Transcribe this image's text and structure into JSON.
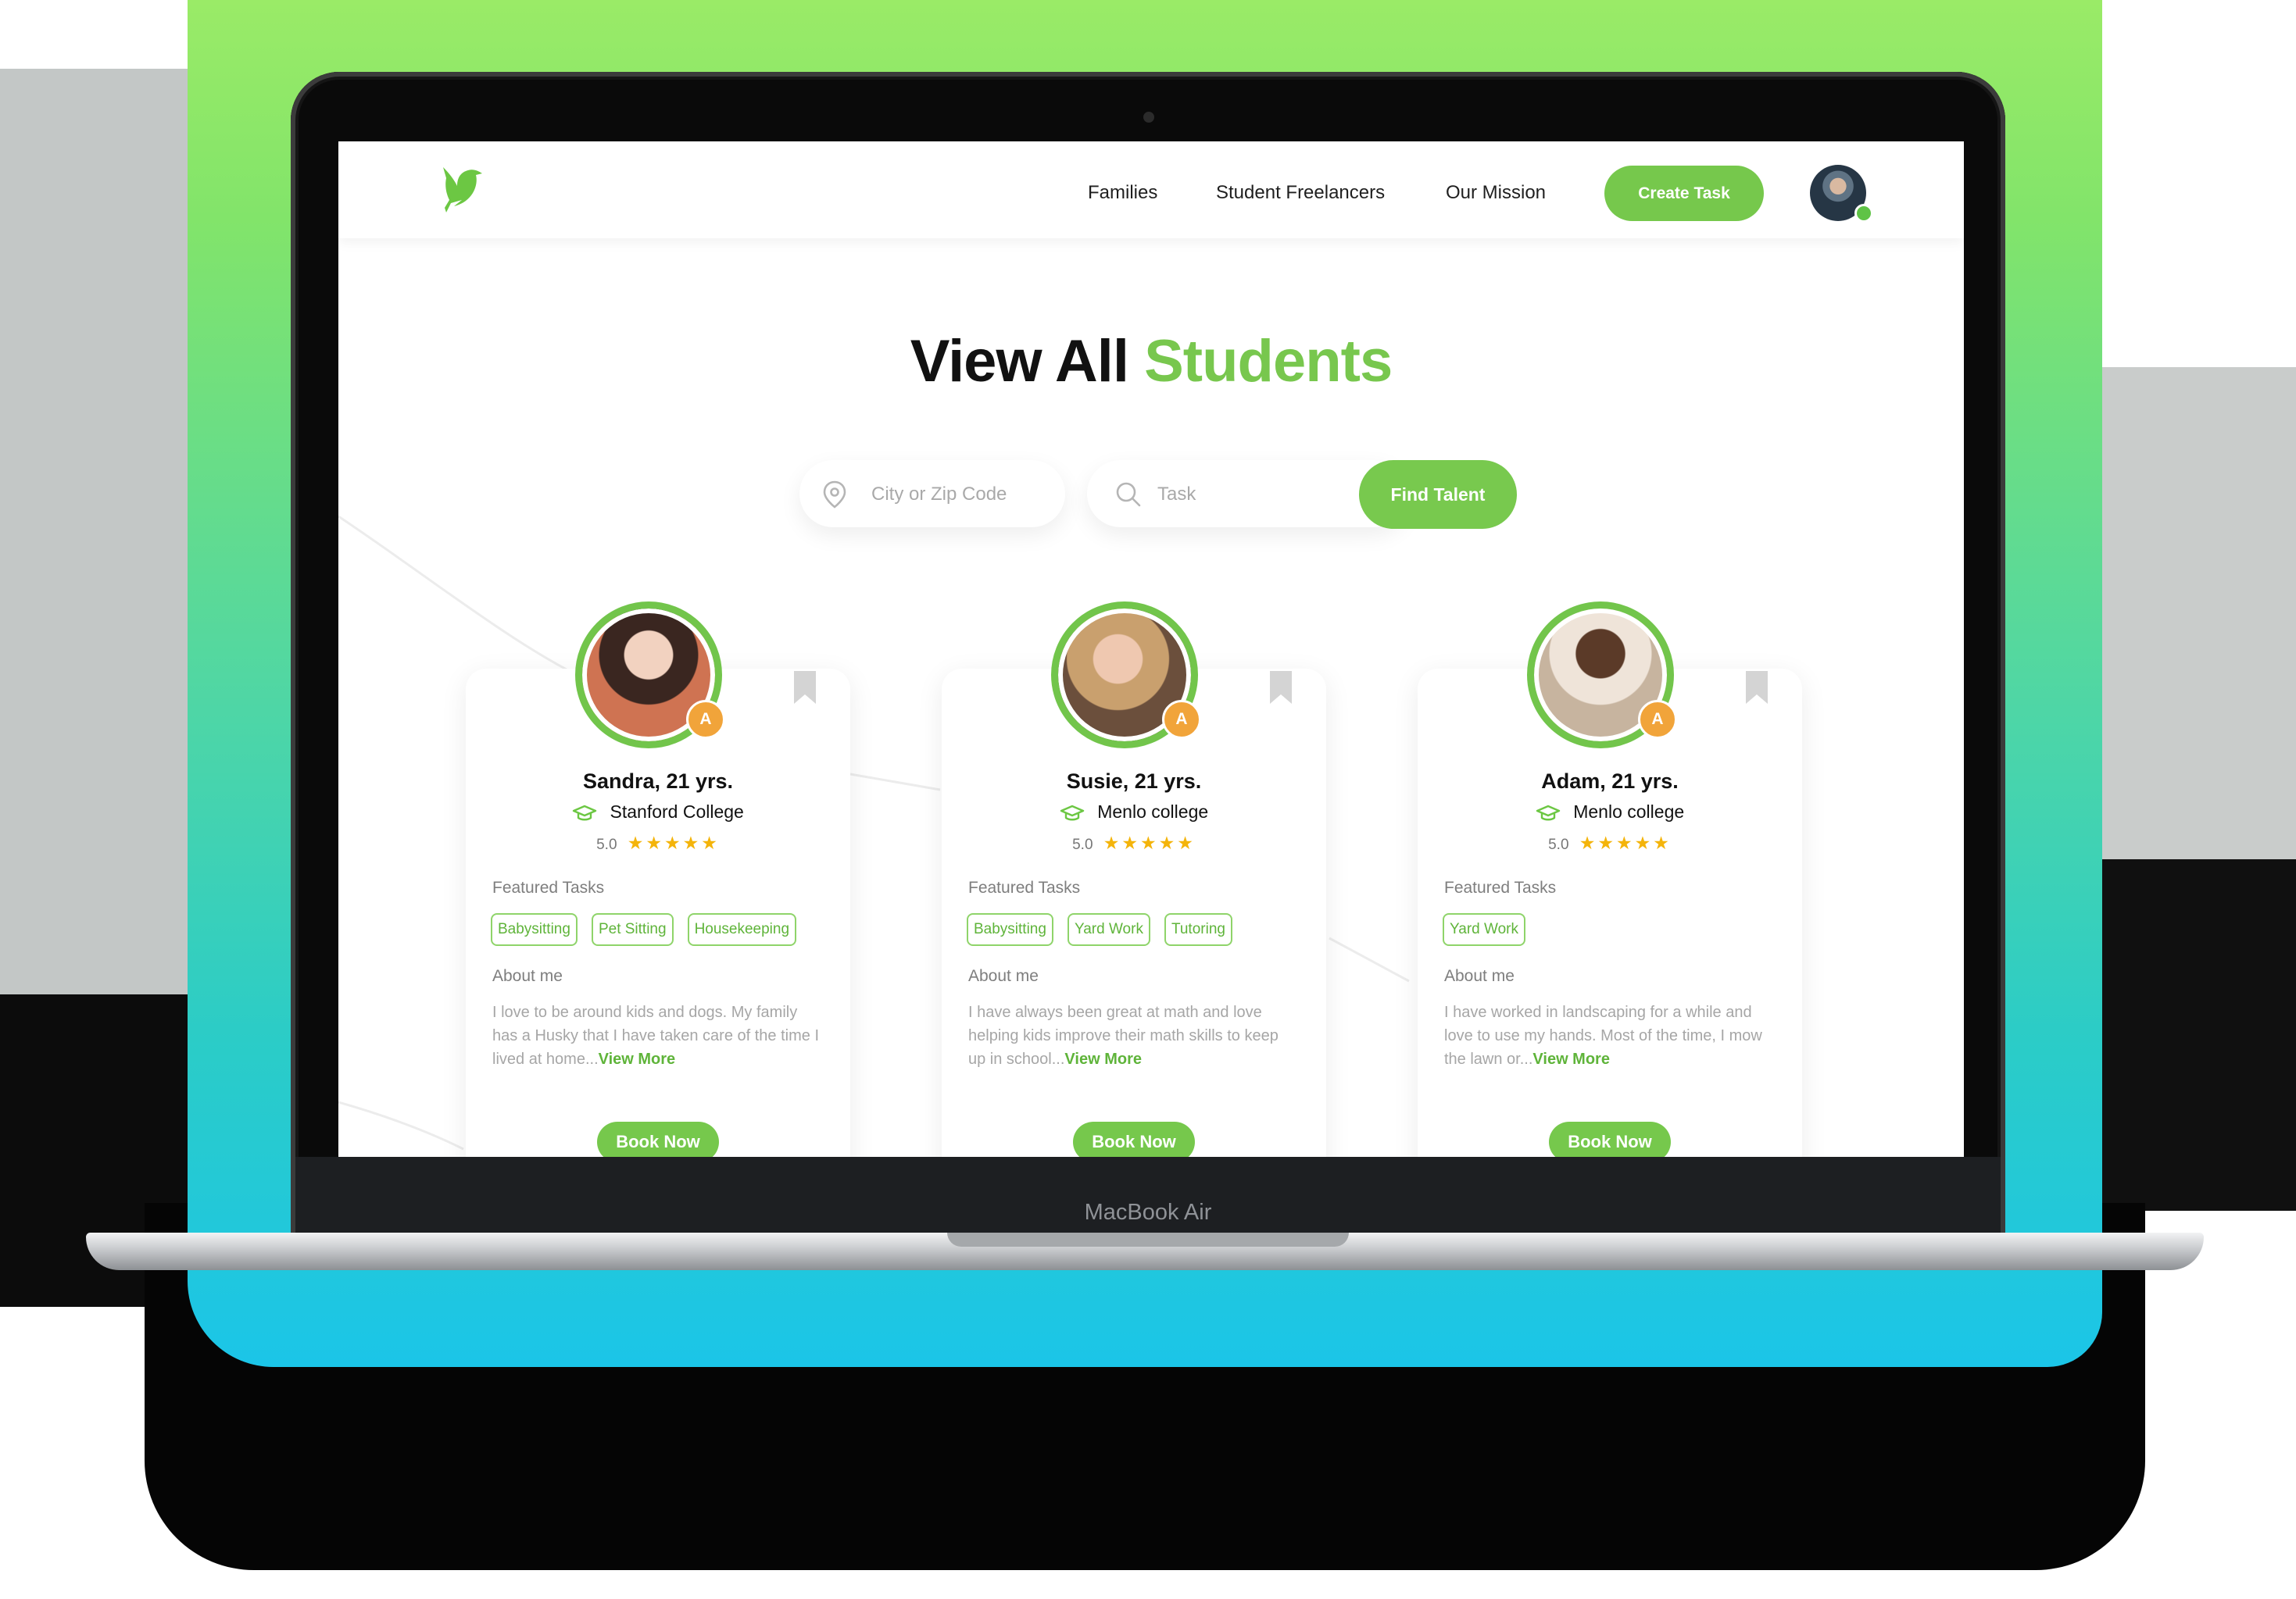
{
  "device": {
    "label": "MacBook Air"
  },
  "nav": {
    "links": [
      "Families",
      "Student Freelancers",
      "Our Mission"
    ],
    "create_task": "Create Task"
  },
  "hero": {
    "title_main": "View All",
    "title_accent": "Students"
  },
  "search": {
    "city_placeholder": "City or Zip Code",
    "task_placeholder": "Task",
    "button": "Find Talent"
  },
  "cards": [
    {
      "name": "Sandra, 21 yrs.",
      "school": "Stanford College",
      "rating": "5.0",
      "stars": "★★★★★",
      "badge": "A",
      "featured_label": "Featured Tasks",
      "tags": [
        "Babysitting",
        "Pet Sitting",
        "Housekeeping"
      ],
      "about_label": "About me",
      "about": "I love to be around kids and dogs. My family has a Husky that I have taken care of the time I lived at home...",
      "view_more": "View More",
      "book": "Book Now"
    },
    {
      "name": "Susie, 21 yrs.",
      "school": "Menlo college",
      "rating": "5.0",
      "stars": "★★★★★",
      "badge": "A",
      "featured_label": "Featured Tasks",
      "tags": [
        "Babysitting",
        "Yard Work",
        "Tutoring"
      ],
      "about_label": "About me",
      "about": "I have always been great at math and love helping kids improve their math skills to keep up in school...",
      "view_more": "View More",
      "book": "Book Now"
    },
    {
      "name": "Adam, 21 yrs.",
      "school": "Menlo college",
      "rating": "5.0",
      "stars": "★★★★★",
      "badge": "A",
      "featured_label": "Featured Tasks",
      "tags": [
        "Yard Work"
      ],
      "about_label": "About me",
      "about": "I have worked in landscaping for a while and love to use my hands. Most of the time, I mow the lawn or...",
      "view_more": "View More",
      "book": "Book Now"
    }
  ],
  "colors": {
    "accent": "#78c74e",
    "star": "#f4b40a",
    "badge": "#f1a43a"
  },
  "icons": [
    "bird-logo-icon",
    "location-pin-icon",
    "search-icon",
    "graduation-cap-icon",
    "bookmark-icon",
    "star-icon"
  ]
}
